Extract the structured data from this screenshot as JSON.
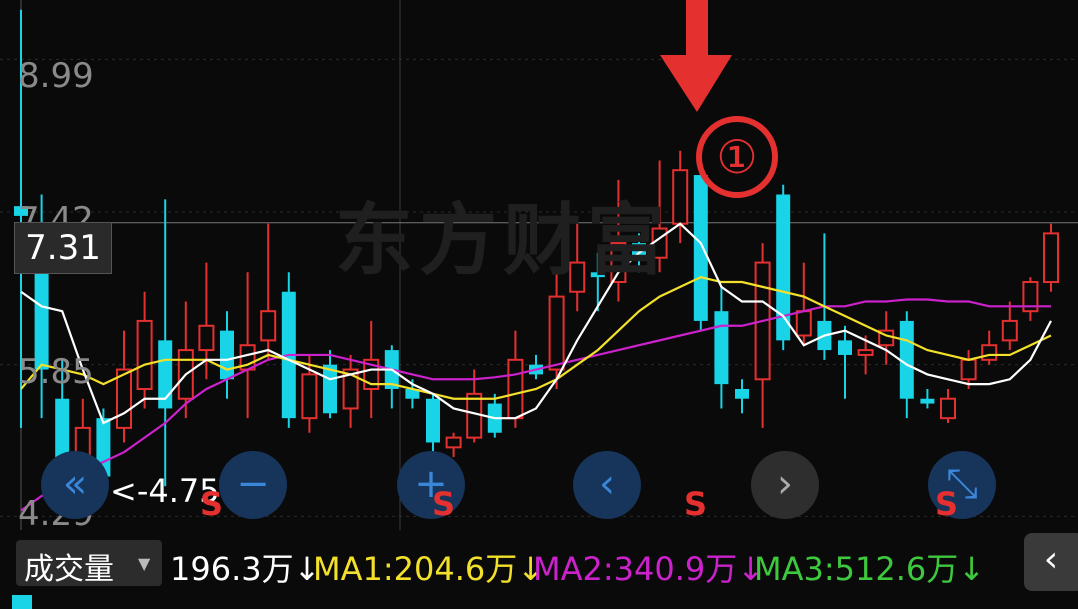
{
  "watermark": "东方财富",
  "axis": {
    "y_labels": [
      "8.99",
      "7.42",
      "5.85",
      "4.29"
    ],
    "cursor_price": "7.31",
    "min_label": "<-4.75"
  },
  "annotation": {
    "marker": "①"
  },
  "nav_buttons": [
    {
      "name": "rewind-double-left-icon",
      "glyph": "«",
      "style": "blue"
    },
    {
      "name": "zoom-out-minus-icon",
      "glyph": "−",
      "style": "blue"
    },
    {
      "name": "zoom-in-plus-icon",
      "glyph": "+",
      "style": "blue"
    },
    {
      "name": "chevron-left-icon",
      "glyph": "‹",
      "style": "blue"
    },
    {
      "name": "chevron-right-icon",
      "glyph": "›",
      "style": "gray"
    },
    {
      "name": "fullscreen-expand-icon",
      "glyph": "⤡",
      "style": "blue"
    }
  ],
  "s_markers": [
    "S",
    "S",
    "S",
    "S"
  ],
  "volume_bar": {
    "selector_label": "成交量",
    "volume": "196.3万↓",
    "ma1": "MA1:204.6万↓",
    "ma2": "MA2:340.9万↓",
    "ma3": "MA3:512.6万↓"
  },
  "colors": {
    "up": "#e53030",
    "down": "#19d3e6",
    "ma_white": "#ffffff",
    "ma_yellow": "#f2e02a",
    "ma_magenta": "#cc22cc",
    "ma3_green": "#3ec83e"
  },
  "chart_data": {
    "type": "candlestick",
    "y_ticks": [
      8.99,
      7.42,
      5.85,
      4.29
    ],
    "ylim": [
      4.15,
      9.6
    ],
    "candles": [
      {
        "o": 7.38,
        "c": 7.48,
        "h": 9.5,
        "l": 5.2,
        "up": false
      },
      {
        "o": 7.25,
        "c": 5.8,
        "h": 7.6,
        "l": 5.3,
        "up": false
      },
      {
        "o": 5.5,
        "c": 4.9,
        "h": 5.9,
        "l": 4.7,
        "up": false
      },
      {
        "o": 4.9,
        "c": 5.2,
        "h": 5.5,
        "l": 4.8,
        "up": true
      },
      {
        "o": 5.3,
        "c": 4.7,
        "h": 5.4,
        "l": 4.55,
        "up": false
      },
      {
        "o": 5.2,
        "c": 5.8,
        "h": 6.2,
        "l": 5.05,
        "up": true
      },
      {
        "o": 5.6,
        "c": 6.3,
        "h": 6.6,
        "l": 5.4,
        "up": true
      },
      {
        "o": 6.1,
        "c": 5.4,
        "h": 7.55,
        "l": 4.6,
        "up": false
      },
      {
        "o": 5.5,
        "c": 6.0,
        "h": 6.5,
        "l": 5.3,
        "up": true
      },
      {
        "o": 6.0,
        "c": 6.25,
        "h": 6.9,
        "l": 5.7,
        "up": true
      },
      {
        "o": 6.2,
        "c": 5.7,
        "h": 6.4,
        "l": 5.5,
        "up": false
      },
      {
        "o": 5.8,
        "c": 6.05,
        "h": 6.8,
        "l": 5.3,
        "up": true
      },
      {
        "o": 6.1,
        "c": 6.4,
        "h": 7.3,
        "l": 5.9,
        "up": true
      },
      {
        "o": 6.6,
        "c": 5.3,
        "h": 6.8,
        "l": 5.2,
        "up": false
      },
      {
        "o": 5.3,
        "c": 5.75,
        "h": 5.95,
        "l": 5.15,
        "up": true
      },
      {
        "o": 5.85,
        "c": 5.35,
        "h": 6.0,
        "l": 5.3,
        "up": false
      },
      {
        "o": 5.4,
        "c": 5.8,
        "h": 5.95,
        "l": 5.2,
        "up": true
      },
      {
        "o": 5.6,
        "c": 5.9,
        "h": 6.3,
        "l": 5.3,
        "up": true
      },
      {
        "o": 6.0,
        "c": 5.6,
        "h": 6.05,
        "l": 5.4,
        "up": false
      },
      {
        "o": 5.6,
        "c": 5.5,
        "h": 5.7,
        "l": 5.4,
        "up": false
      },
      {
        "o": 5.5,
        "c": 5.05,
        "h": 5.55,
        "l": 4.95,
        "up": false
      },
      {
        "o": 5.0,
        "c": 5.1,
        "h": 5.15,
        "l": 4.9,
        "up": true
      },
      {
        "o": 5.1,
        "c": 5.55,
        "h": 5.8,
        "l": 5.05,
        "up": true
      },
      {
        "o": 5.45,
        "c": 5.15,
        "h": 5.55,
        "l": 5.1,
        "up": false
      },
      {
        "o": 5.3,
        "c": 5.9,
        "h": 6.2,
        "l": 5.2,
        "up": true
      },
      {
        "o": 5.85,
        "c": 5.75,
        "h": 5.95,
        "l": 5.7,
        "up": false
      },
      {
        "o": 5.8,
        "c": 6.55,
        "h": 6.85,
        "l": 5.6,
        "up": true
      },
      {
        "o": 6.6,
        "c": 6.9,
        "h": 7.3,
        "l": 6.4,
        "up": true
      },
      {
        "o": 6.8,
        "c": 6.75,
        "h": 7.0,
        "l": 6.4,
        "up": false
      },
      {
        "o": 6.7,
        "c": 7.1,
        "h": 7.75,
        "l": 6.5,
        "up": true
      },
      {
        "o": 7.1,
        "c": 6.95,
        "h": 7.2,
        "l": 6.8,
        "up": false
      },
      {
        "o": 6.95,
        "c": 7.25,
        "h": 7.95,
        "l": 6.8,
        "up": true
      },
      {
        "o": 7.3,
        "c": 7.85,
        "h": 8.05,
        "l": 7.1,
        "up": true
      },
      {
        "o": 7.8,
        "c": 6.3,
        "h": 7.95,
        "l": 6.2,
        "up": false
      },
      {
        "o": 6.4,
        "c": 5.65,
        "h": 6.65,
        "l": 5.4,
        "up": false
      },
      {
        "o": 5.6,
        "c": 5.5,
        "h": 5.7,
        "l": 5.35,
        "up": false
      },
      {
        "o": 5.7,
        "c": 6.9,
        "h": 7.1,
        "l": 5.2,
        "up": true
      },
      {
        "o": 7.6,
        "c": 6.1,
        "h": 7.7,
        "l": 6.0,
        "up": false
      },
      {
        "o": 6.15,
        "c": 6.4,
        "h": 6.9,
        "l": 6.05,
        "up": true
      },
      {
        "o": 6.3,
        "c": 6.0,
        "h": 7.2,
        "l": 5.9,
        "up": false
      },
      {
        "o": 6.1,
        "c": 5.95,
        "h": 6.25,
        "l": 5.5,
        "up": false
      },
      {
        "o": 5.95,
        "c": 6.0,
        "h": 6.15,
        "l": 5.75,
        "up": true
      },
      {
        "o": 6.05,
        "c": 6.2,
        "h": 6.4,
        "l": 5.85,
        "up": true
      },
      {
        "o": 6.3,
        "c": 5.5,
        "h": 6.4,
        "l": 5.3,
        "up": false
      },
      {
        "o": 5.5,
        "c": 5.45,
        "h": 5.6,
        "l": 5.4,
        "up": false
      },
      {
        "o": 5.3,
        "c": 5.5,
        "h": 5.6,
        "l": 5.25,
        "up": true
      },
      {
        "o": 5.7,
        "c": 5.9,
        "h": 6.0,
        "l": 5.6,
        "up": true
      },
      {
        "o": 5.9,
        "c": 6.05,
        "h": 6.2,
        "l": 5.85,
        "up": true
      },
      {
        "o": 6.1,
        "c": 6.3,
        "h": 6.5,
        "l": 6.0,
        "up": true
      },
      {
        "o": 6.4,
        "c": 6.7,
        "h": 6.75,
        "l": 6.3,
        "up": true
      },
      {
        "o": 6.7,
        "c": 7.2,
        "h": 7.3,
        "l": 6.6,
        "up": true
      }
    ],
    "ma_white": [
      6.6,
      6.45,
      6.4,
      5.8,
      5.25,
      5.35,
      5.5,
      5.5,
      5.75,
      5.9,
      5.9,
      5.95,
      6.0,
      5.9,
      5.8,
      5.7,
      5.75,
      5.8,
      5.8,
      5.65,
      5.55,
      5.4,
      5.35,
      5.3,
      5.3,
      5.4,
      5.7,
      6.1,
      6.45,
      6.8,
      7.0,
      7.15,
      7.3,
      7.1,
      6.65,
      6.5,
      6.5,
      6.35,
      6.05,
      6.15,
      6.2,
      6.1,
      6.0,
      5.85,
      5.75,
      5.7,
      5.65,
      5.65,
      5.7,
      5.9,
      6.3
    ],
    "ma_yellow": [
      5.6,
      5.85,
      5.8,
      5.75,
      5.65,
      5.75,
      5.85,
      5.9,
      5.9,
      5.9,
      5.8,
      5.85,
      5.95,
      5.9,
      5.85,
      5.8,
      5.75,
      5.65,
      5.65,
      5.6,
      5.55,
      5.5,
      5.5,
      5.5,
      5.55,
      5.6,
      5.7,
      5.85,
      6.0,
      6.2,
      6.4,
      6.55,
      6.65,
      6.75,
      6.7,
      6.7,
      6.65,
      6.6,
      6.55,
      6.45,
      6.35,
      6.25,
      6.15,
      6.1,
      6.0,
      5.95,
      5.9,
      5.95,
      5.95,
      6.05,
      6.15
    ],
    "ma_magenta": [
      4.35,
      4.5,
      4.6,
      4.75,
      4.85,
      4.95,
      5.1,
      5.25,
      5.45,
      5.6,
      5.7,
      5.8,
      5.9,
      5.95,
      5.95,
      5.95,
      5.9,
      5.85,
      5.8,
      5.75,
      5.7,
      5.7,
      5.7,
      5.72,
      5.75,
      5.8,
      5.85,
      5.9,
      5.95,
      6.0,
      6.05,
      6.1,
      6.15,
      6.2,
      6.25,
      6.25,
      6.3,
      6.35,
      6.4,
      6.45,
      6.45,
      6.5,
      6.5,
      6.52,
      6.52,
      6.5,
      6.5,
      6.45,
      6.45,
      6.45,
      6.45
    ]
  }
}
